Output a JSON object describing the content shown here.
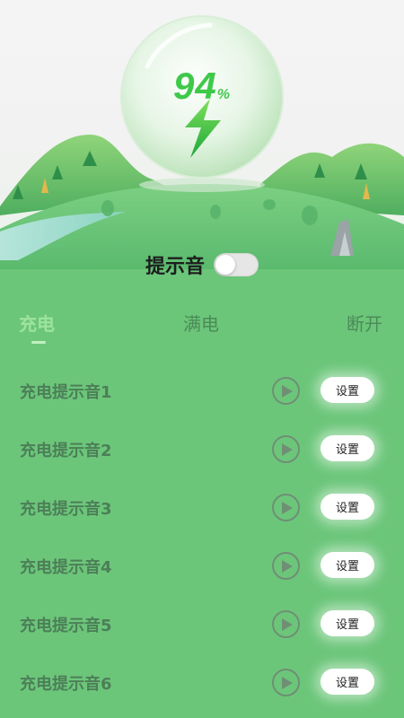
{
  "battery": {
    "percent": "94",
    "unit": "%",
    "level": 0.94
  },
  "sound": {
    "label": "提示音",
    "enabled": false
  },
  "tabs": [
    {
      "label": "充电",
      "active": true
    },
    {
      "label": "满电",
      "active": false
    },
    {
      "label": "断开",
      "active": false
    }
  ],
  "items": [
    {
      "label": "充电提示音1",
      "play_icon": "play-icon",
      "button_label": "设置"
    },
    {
      "label": "充电提示音2",
      "play_icon": "play-icon",
      "button_label": "设置"
    },
    {
      "label": "充电提示音3",
      "play_icon": "play-icon",
      "button_label": "设置"
    },
    {
      "label": "充电提示音4",
      "play_icon": "play-icon",
      "button_label": "设置"
    },
    {
      "label": "充电提示音5",
      "play_icon": "play-icon",
      "button_label": "设置"
    },
    {
      "label": "充电提示音6",
      "play_icon": "play-icon",
      "button_label": "设置"
    }
  ],
  "colors": {
    "background": "#6cc67a",
    "accent": "#3fc94a",
    "active_tab": "#9de39f"
  }
}
